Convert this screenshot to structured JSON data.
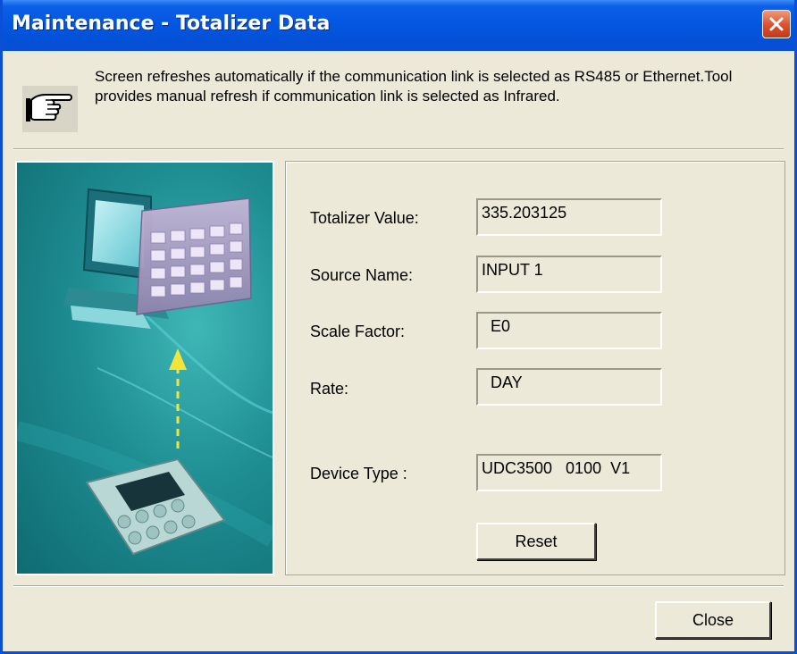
{
  "window": {
    "title": "Maintenance - Totalizer Data"
  },
  "info": {
    "icon": "pointing-hand-icon",
    "text": "Screen refreshes automatically if the communication link is selected as RS485 or Ethernet.Tool provides manual refresh if communication link is selected as Infrared."
  },
  "fields": {
    "totalizer_value_label": "Totalizer Value:",
    "totalizer_value": "335.203125",
    "source_name_label": "Source Name:",
    "source_name": "INPUT 1",
    "scale_factor_label": "Scale Factor:",
    "scale_factor": "  E0",
    "rate_label": "Rate:",
    "rate": "  DAY",
    "device_type_label": "Device Type :",
    "device_type": "UDC3500   0100  V1"
  },
  "buttons": {
    "reset": "Reset",
    "close": "Close"
  },
  "colors": {
    "titlebar": "#0457e1",
    "dialog_bg": "#ece9d8",
    "close_x": "#d9502c",
    "illustration_teal": "#1e8e93"
  }
}
